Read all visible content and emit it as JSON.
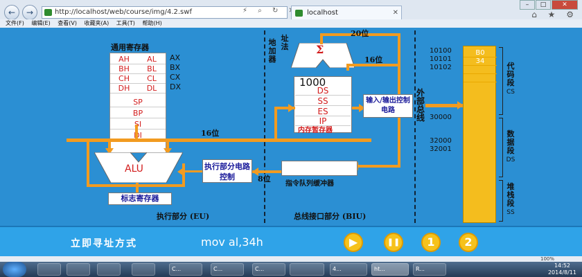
{
  "browser": {
    "url": "http://localhost/web/course/img/4.2.swf",
    "tab_title": "localhost",
    "menu": [
      "文件(F)",
      "编辑(E)",
      "查看(V)",
      "收藏夹(A)",
      "工具(T)",
      "帮助(H)"
    ],
    "zoom": "100%"
  },
  "diagram": {
    "gpr_title": "通用寄存器",
    "gpr_rows": [
      [
        "AH",
        "AL"
      ],
      [
        "BH",
        "BL"
      ],
      [
        "CH",
        "CL"
      ],
      [
        "DH",
        "DL"
      ]
    ],
    "gpr_names": [
      "AX",
      "BX",
      "CX",
      "DX"
    ],
    "gpr_single": [
      "SP",
      "BP",
      "SI",
      "DI"
    ],
    "alu": "ALU",
    "flag_reg": "标志寄存器",
    "exec_ctrl": "执行部分电路控制",
    "eu_label": "执行部分 (EU)",
    "biu_label": "总线接口部分 (BIU)",
    "bus16": "16位",
    "bus16b": "16位",
    "bus20": "20位",
    "bus8": "8位",
    "adder": "地址加法器",
    "adder_sigma": "Σ",
    "seg_value": "1000",
    "seg_regs": [
      "DS",
      "SS",
      "ES",
      "IP"
    ],
    "mem_reg_title": "内存暂存器",
    "io_ctrl": "输入/输出控制电路",
    "ext_bus": "外部总线",
    "queue": "指令队列缓冲器",
    "mem_cells": [
      "B0",
      "34"
    ],
    "addresses": [
      "10100",
      "10101",
      "10102",
      "30000",
      "32000",
      "32001"
    ],
    "segments": [
      {
        "cn": "代码段",
        "en": "CS"
      },
      {
        "cn": "数据段",
        "en": "DS"
      },
      {
        "cn": "堆栈段",
        "en": "SS"
      }
    ]
  },
  "controls": {
    "title": "立即寻址方式",
    "code": "mov al,34h",
    "buttons": [
      "▶",
      "❚❚",
      "1",
      "2"
    ]
  },
  "taskbar": {
    "items": [
      "C...",
      "C...",
      "C...",
      "4...",
      "ht...",
      "R..."
    ],
    "time": "14:52",
    "date": "2014/8/11"
  },
  "colors": {
    "stage": "#2b8fd3",
    "bus": "#f29b20",
    "memory": "#f4bd1e",
    "register_text": "#d21c1c"
  }
}
